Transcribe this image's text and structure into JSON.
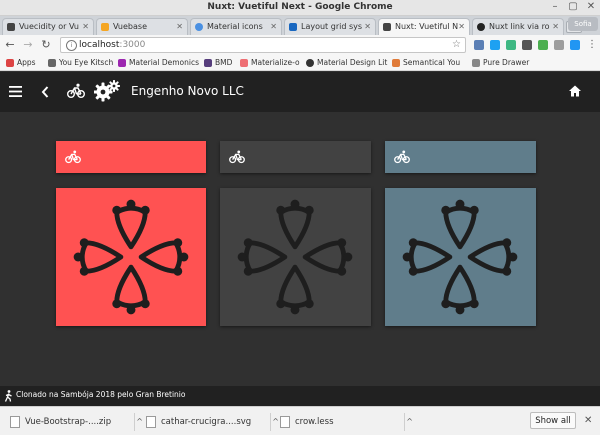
{
  "window": {
    "title": "Nuxt: Vuetiful Next - Google Chrome"
  },
  "tabs": [
    {
      "label": "Vuecidity or Vu",
      "icon": "biohazard-icon",
      "color": "#444444"
    },
    {
      "label": "Vuebase",
      "icon": "vuebase-icon",
      "color": "#f5a623"
    },
    {
      "label": "Material icons",
      "icon": "material-icons-icon",
      "color": "#4a90e2"
    },
    {
      "label": "Layout grid sys",
      "icon": "vuetify-icon",
      "color": "#1867c0"
    },
    {
      "label": "Nuxt: Vuetiful N",
      "icon": "biohazard-icon",
      "color": "#444444",
      "active": true
    },
    {
      "label": "Nuxt link via ro",
      "icon": "github-icon",
      "color": "#222222"
    }
  ],
  "incognito_label": "Sofia",
  "toolbar": {
    "url_host": "localhost",
    "url_port": ":3000"
  },
  "bookmarks": [
    {
      "label": "Apps",
      "color": "#d44"
    },
    {
      "label": "You Eye Kitsch",
      "color": "#666"
    },
    {
      "label": "Material Demonics",
      "color": "#9c27b0"
    },
    {
      "label": "BMD",
      "color": "#563d7c"
    },
    {
      "label": "Materialize-o",
      "color": "#ee6e73"
    },
    {
      "label": "Material Design Lit",
      "color": "#333"
    },
    {
      "label": "Semantical You",
      "color": "#e07b39"
    },
    {
      "label": "Pure Drawer",
      "color": "#888"
    }
  ],
  "app": {
    "title": "Engenho Novo LLC"
  },
  "colors": {
    "red": "#ff5252",
    "dark": "#424242",
    "slate": "#607d8b",
    "cross": "#1e1e1e"
  },
  "cards": [
    {
      "name": "red",
      "color": "#ff5252"
    },
    {
      "name": "dark",
      "color": "#424242"
    },
    {
      "name": "slate",
      "color": "#607d8b"
    }
  ],
  "footer": {
    "text": "Clonado na Sambója 2018 pelo Gran Bretinio"
  },
  "downloads": {
    "items": [
      "Vue-Bootstrap-....zip",
      "cathar-crucigra....svg",
      "crow.less"
    ],
    "show_all": "Show all"
  }
}
